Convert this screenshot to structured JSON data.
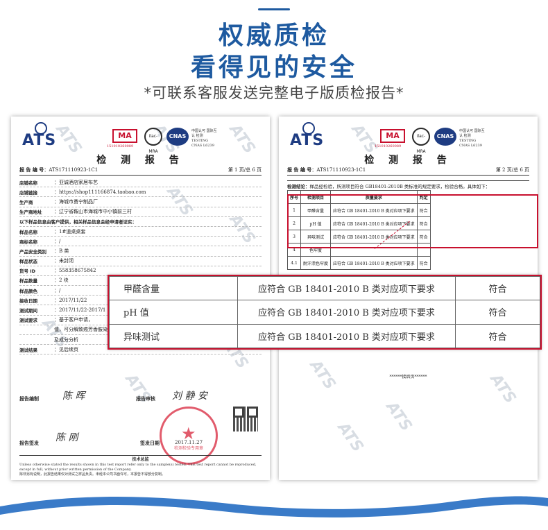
{
  "header": {
    "title_line1": "权威质检",
    "title_line2": "看得见的安全",
    "subtitle": "*可联系客服发送完整电子版质检报告*"
  },
  "colors": {
    "brand_blue": "#1e5aa0",
    "highlight_red": "#c8102e",
    "stamp_red": "#d8253b"
  },
  "logos": {
    "ats": "ATS",
    "ma": "MA",
    "ma_number": "151010260089",
    "ilac": "ilac-MRA",
    "cnas": "CNAS",
    "cnas_caption": "中国认可 国际互认 检测 TESTING CNAS L6239"
  },
  "watermark": "ATS",
  "report_left": {
    "title": "检 测 报 告",
    "report_no_label": "报 告 编 号",
    "report_no": "ATS171110923-1C1",
    "page": "第 1 页/总 6 页",
    "fields": [
      {
        "label": "店铺名称",
        "value": "：亚诚酒店家居布艺"
      },
      {
        "label": "店铺链接",
        "value": "：https://shop111166874.taobao.com"
      },
      {
        "label": "生产商",
        "value": "：海城市勇宁制品厂"
      },
      {
        "label": "生产商地址",
        "value": "：辽宁省鞍山市海城市中小镇前三村"
      },
      {
        "label": "以下样品信息由客户提供，相关样品信息会经申请者证实：",
        "value": "",
        "note": true
      },
      {
        "label": "样品名称",
        "value": "：1#道桌桌套"
      },
      {
        "label": "商标名称",
        "value": "：/"
      },
      {
        "label": "产品安全类别",
        "value": "：B 类"
      },
      {
        "label": "样品状态",
        "value": "：未封闭"
      },
      {
        "label": "货号 ID",
        "value": "：558358675842"
      },
      {
        "label": "样品数量",
        "value": "：2 块"
      },
      {
        "label": "样品颜色",
        "value": "：/"
      },
      {
        "label": "接收日期",
        "value": "：2017/11/22"
      },
      {
        "label": "测试期间",
        "value": "：2017/11/22-2017/1"
      },
      {
        "label": "测试要求",
        "value": "：基于客户申请，"
      },
      {
        "label": "",
        "value": "值，可分解致癌芳香胺染料，耐汗渍色牢度，耐水色牢度，耐干摩擦色牢度"
      },
      {
        "label": "",
        "value": "及成分分析"
      },
      {
        "label": "测试结果",
        "value": "：见后续页"
      }
    ],
    "report_maker_label": "报告编制",
    "reviewer_label": "报告审核",
    "approver_label": "报告签发",
    "issue_date_label": "签发日期",
    "signature_1": "陈 晖",
    "signature_2": "刘 静 安",
    "signature_3": "陈 刚",
    "stamp_text": "检测检验专用章",
    "stamp_date": "2017.11.27",
    "footer_title": "技术总监",
    "footer_en": "Unless otherwise stated the results shown in this test report refer only to the sample(s) tested. This test report cannot be reproduced, except in full, without prior written permission of the Company.",
    "footer_cn": "除非另有说明，此报告结果仅对测试之样品负责。未经本公司书面许可，本报告不得部分复制。"
  },
  "report_right": {
    "title": "检 测 报 告",
    "report_no_label": "报 告 编 号",
    "report_no": "ATS171110923-1C1",
    "page": "第 2 页/总 6 页",
    "conclusion_label": "检测结论",
    "conclusion_text": "样品经检验，所测项目符合 GB18401-2010B 类标准的规定要求，检验合格。具体如下：",
    "table_headers": [
      "序号",
      "检测项目",
      "质量要求",
      "判定"
    ],
    "table_rows": [
      [
        "1",
        "甲醛含量",
        "应符合 GB 18401-2010 B 类对应项下要求",
        "符合"
      ],
      [
        "2",
        "pH 值",
        "应符合 GB 18401-2010 B 类对应项下要求",
        "符合"
      ],
      [
        "3",
        "异味测试",
        "应符合 GB 18401-2010 B 类对应项下要求",
        "符合"
      ],
      [
        "4",
        "色牢度",
        "",
        ""
      ],
      [
        "4.1",
        "耐汗渍色牢度",
        "应符合 GB 18401-2010 B 类对应项下要求",
        "符合"
      ]
    ],
    "end_mark": "******接后页******"
  },
  "zoom_rows": [
    {
      "item": "甲醛含量",
      "requirement": "应符合 GB 18401-2010 B 类对应项下要求",
      "result": "符合"
    },
    {
      "item": "pH 值",
      "requirement": "应符合 GB 18401-2010 B 类对应项下要求",
      "result": "符合"
    },
    {
      "item": "异味测试",
      "requirement": "应符合 GB 18401-2010 B 类对应项下要求",
      "result": "符合"
    }
  ]
}
